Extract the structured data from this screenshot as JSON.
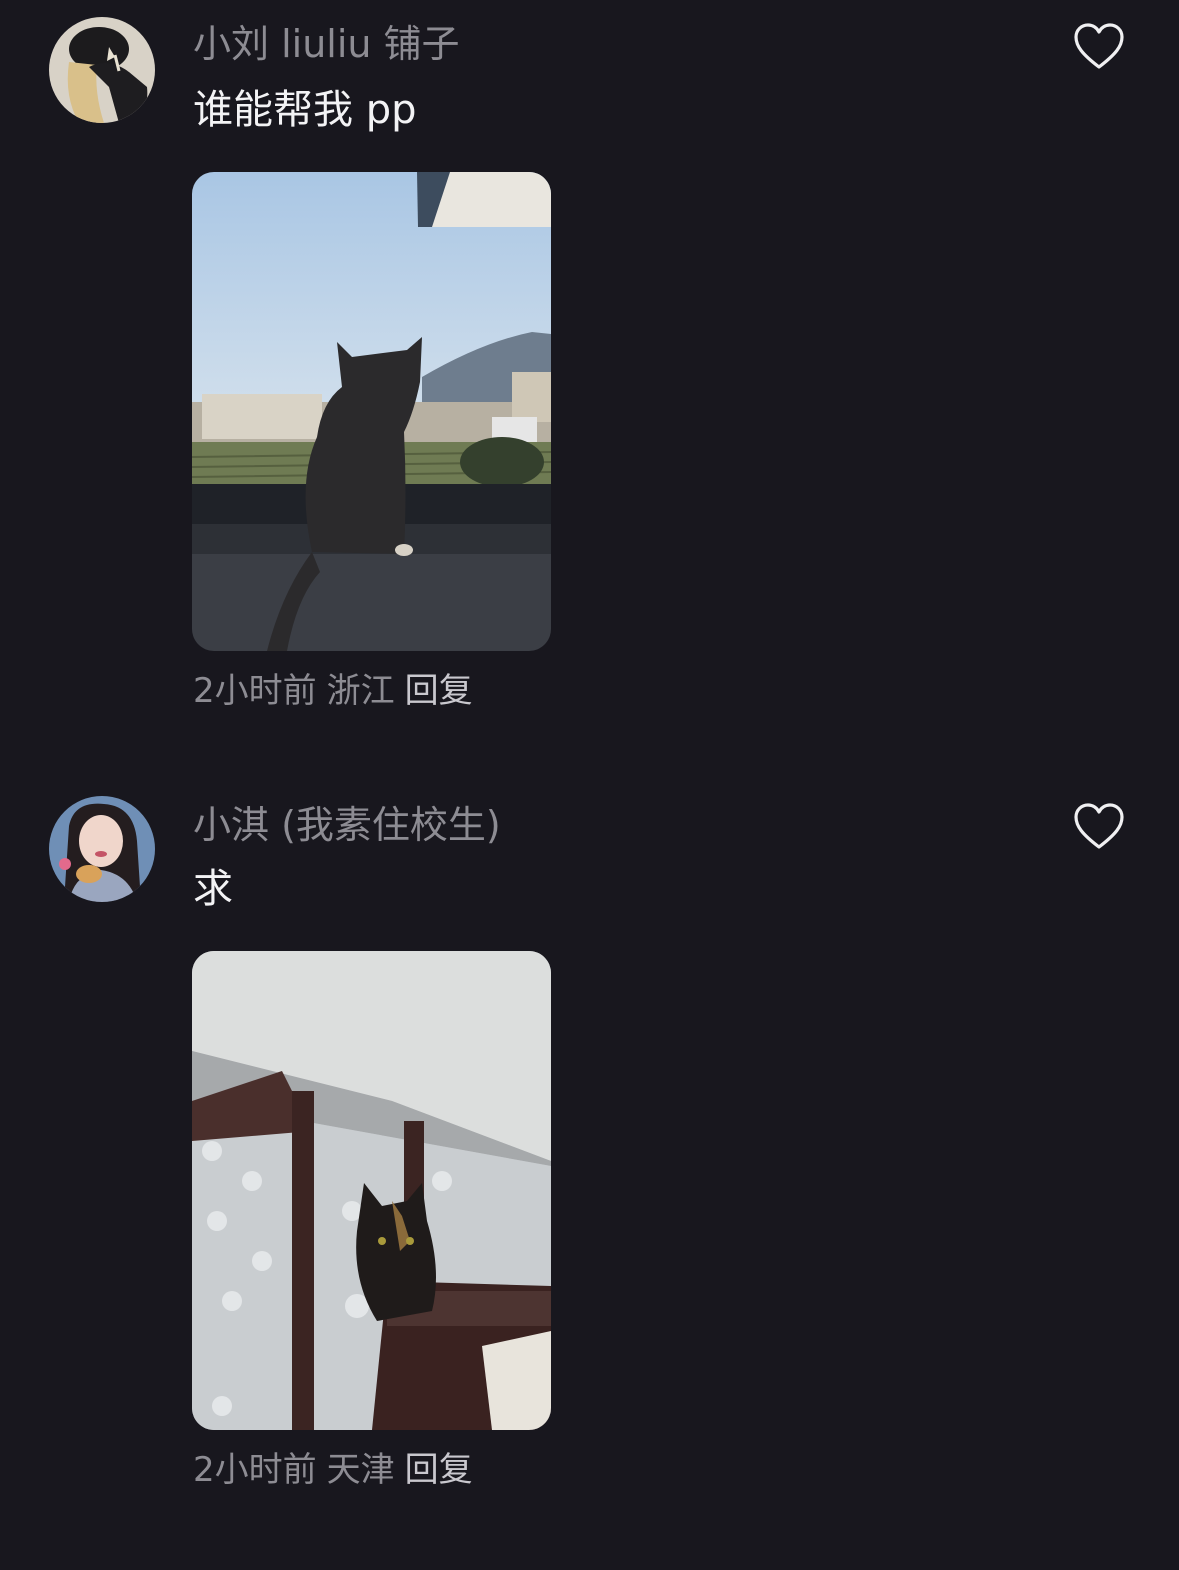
{
  "comments": [
    {
      "username": "小刘 liuliu 铺子",
      "text": "谁能帮我 pp",
      "time": "2小时前",
      "location": "浙江",
      "reply_label": "回复",
      "liked": false,
      "like_icon": "heart-outline-icon",
      "avatar": "user-avatar",
      "photo": "cat-sitting-on-windowsill-photo"
    },
    {
      "username": "小淇 (我素住校生)",
      "text": "求",
      "time": "2小时前",
      "location": "天津",
      "reply_label": "回复",
      "liked": false,
      "like_icon": "heart-outline-icon",
      "avatar": "user-avatar",
      "photo": "cat-on-staircase-photo"
    }
  ],
  "colors": {
    "background": "#18171e",
    "secondary_text": "#8d8c93",
    "primary_text": "#f3f3f5",
    "reply_text": "#c9c8ce"
  }
}
